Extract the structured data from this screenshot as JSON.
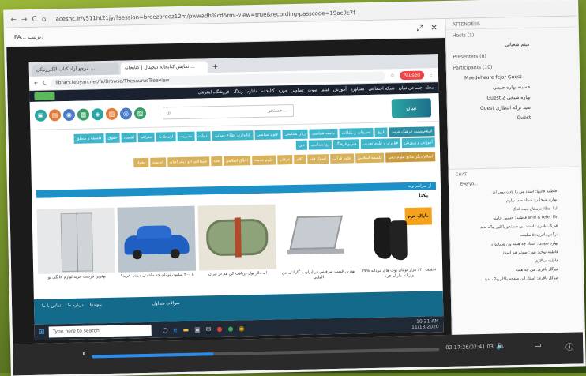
{
  "window": {
    "url": "aceshc.ir/y511ht21jy/?session=breezbreez12m/pwwadh%cd5rmi-view=true&recording-passcode=19ac9c7f",
    "meeting_title": "PA... ترتیب:"
  },
  "shared_browser": {
    "tabs": [
      "نمایش کتابخانه دیجیتال | کتابخانه ...",
      "مرجع آزاد کتاب الکترونیکی ..."
    ],
    "url": "library.tebyan.net/fa/Browse/ThesaurusTreeview",
    "recent_label": "Paused",
    "top_nav": [
      "فروشگاه اینترنتی",
      "وبلاگ",
      "دانلود",
      "کتابخانه",
      "حوزه",
      "تصاویر",
      "صوت",
      "فیلم",
      "آموزش",
      "مشاوره",
      "شبکه اجتماعی",
      "مجله اجتماعی تبیان"
    ],
    "search_placeholder": "جستجو ...",
    "site_logo": "تبیان",
    "categories_row1": [
      "اسلام/سنت فرهنگ غربی",
      "تاریخ",
      "تحقیقات و مقالات",
      "جامعه شناسی",
      "زبان شناسی",
      "علوم سیاسی",
      "کتابداری اطلاع رسانی",
      "ادبیات",
      "مدیریت",
      "ارتباطات",
      "جغرافیا",
      "اقتصاد",
      "حقوق",
      "فلسفه و منطق"
    ],
    "categories_row2": [
      "آموزش و پرورش",
      "فناوری و علوم تجربی",
      "هنر و فرهنگ",
      "روانشناسی",
      "دین"
    ],
    "categories_row3": [
      "اسلام/دیگر منابع علوم دینی",
      "فلسفه اسلامی",
      "علوم قرآنی",
      "اصول فقه",
      "کلام",
      "عرفان",
      "علوم حدیث",
      "اخلاق اسلامی",
      "فقه",
      "سیدالانبیاء و دیگر ادیان",
      "اندیشه",
      "حقوق"
    ],
    "ad_label": "از سراسر وب",
    "banner": "یکتا",
    "product_captions": [
      "۲۷% تخفیف ۶۴۰ هزار تومان بوت های مردانه و زنانه مارال چرم",
      "بهترین قیمت سرفیس در ایران با گارانتی بین المللی",
      "به دلار پول دریافت کن هم در ایران!",
      "با ۲۰۰ میلیون تومان چه ماشینی میشه خرید؟",
      "بهترین فرصت خرید لوازم خانگی نو"
    ],
    "product_brand": "مارال چرم",
    "footer_links": [
      "تماس با ما",
      "درباره ما",
      "پیوندها"
    ],
    "footer_extra": "سوالات متداول",
    "taskbar_search": "Type here to search",
    "tray_time": "10:21 AM",
    "tray_date": "11/13/2020"
  },
  "attendees": {
    "header": "ATTENDEES",
    "hosts_label": "Hosts (1)",
    "host_name": "میثم شعبانی",
    "presenters_label": "Presenters (0)",
    "participants_label": "Participants (10)",
    "participants": [
      "Maedeheure fejar Guest",
      "حسینه بهاره جنیعی",
      "Guest بهاره شیخی 2",
      "Guest سید نرگه انتظاری",
      "Guest"
    ]
  },
  "chat": {
    "header": "CHAT",
    "messages": [
      "Everyo...",
      "فاطمه فاتیها: استاد من را پادت نمی اند",
      "بهاره شیخانی: استاد صدا ندارم",
      "لیلا عطا: دوستان دیده اندک",
      "فاطمه: حسین خامنه shid & refer Mr",
      "قیرگل باقری: استاد این جستجو باکلیر پیاک ندید",
      "نرگس باقری: ۵ سلینت",
      "بهاره شیخی: استاد چه هفته من شمالبازد",
      "فاطمه توحید پتور: صوتم هم استاد",
      "فاطمه سالاری",
      "قیرگل باقری: من چه هفته",
      "قیرگل باقری: استاد این صفحه پاکلر پیاک ندید"
    ]
  },
  "player": {
    "time": "02:17:26/02:41:03",
    "progress": 0.35
  }
}
